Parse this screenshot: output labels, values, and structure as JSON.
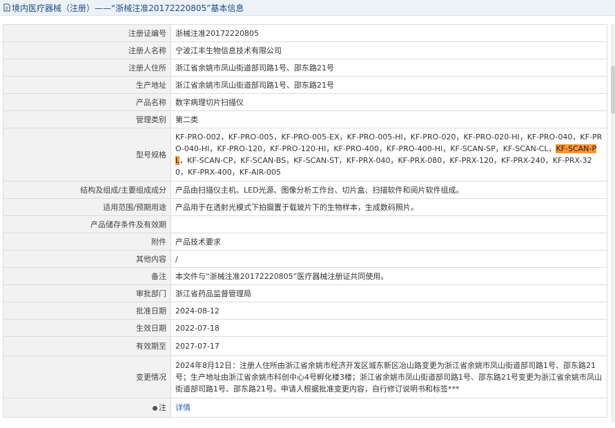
{
  "header": {
    "title": "境内医疗器械（注册）——“浙械注准20172220805”基本信息"
  },
  "rows": [
    {
      "label": "注册证编号",
      "value": "浙械注准20172220805"
    },
    {
      "label": "注册人名称",
      "value": "宁波江丰生物信息技术有限公司"
    },
    {
      "label": "注册人住所",
      "value": "浙江省余姚市凤山街道部司路1号、邵东路21号"
    },
    {
      "label": "生产地址",
      "value": "浙江省余姚市凤山街道部司路1号、邵东路21号"
    },
    {
      "label": "产品名称",
      "value": "数字病理切片扫描仪"
    },
    {
      "label": "管理类别",
      "value": "第二类"
    },
    {
      "label": "型号规格",
      "value_before": "KF-PRO-002，KF-PRO-005，KF-PRO-005-EX，KF-PRO-005-HI，KF-PRO-020，KF-PRO-020-HI，KF-PRO-040，KF-PRO-040-HI，KF-PRO-120，KF-PRO-120-HI，KF-PRO-400，KF-PRO-400-HI，KF-SCAN-SP，KF-SCAN-CL，",
      "value_highlight": "KF-SCAN-PL",
      "value_after": "，KF-SCAN-CP，KF-SCAN-BS，KF-SCAN-ST，KF-PRX-040，KF-PRX-080，KF-PRX-120，KF-PRX-240，KF-PRX-320，KF-PRX-400，KF-AIR-005"
    },
    {
      "label": "结构及组成/主要组成成分",
      "value": "产品由扫描仪主机、LED光源、图像分析工作台、切片盒、扫描软件和阅片软件组成。"
    },
    {
      "label": "适用范围/预期用途",
      "value": "产品用于在透射光模式下拍摄置于载玻片下的生物样本，生成数码照片。"
    },
    {
      "label": "产品储存条件及有效期",
      "value": ""
    },
    {
      "label": "附件",
      "value": "产品技术要求"
    },
    {
      "label": "其他内容",
      "value": "/"
    },
    {
      "label": "备注",
      "value": "本文件与“浙械注准20172220805”医疗器械注册证共同使用。"
    },
    {
      "label": "审批部门",
      "value": "浙江省药品监督管理局"
    },
    {
      "label": "批准日期",
      "value": "2024-08-12"
    },
    {
      "label": "生效日期",
      "value": "2022-07-18"
    },
    {
      "label": "有效期至",
      "value": "2027-07-17"
    },
    {
      "label": "变更情况",
      "value": "2024年8月12日：注册人住所由浙江省余姚市经济开发区城东新区冶山路变更为浙江省余姚市凤山街道部司路1号、邵东路21号；生产地址由浙江省余姚市科创中心4号孵化楼3楼；浙江省余姚市凤山街道部司路1号、邵东路21号变更为浙江省余姚市凤山街道部司路1号、邵东路21号。申请人根据批准变更内容，自行修订说明书和标签***"
    },
    {
      "label": "注",
      "value": "详情"
    }
  ],
  "icons": {
    "header": "document-icon",
    "note": "pin-icon"
  },
  "colors": {
    "link": "#1f5fb5",
    "highlight": "#ff9632",
    "label_bg": "#f2f2f2",
    "header_text": "#1f4a86"
  }
}
